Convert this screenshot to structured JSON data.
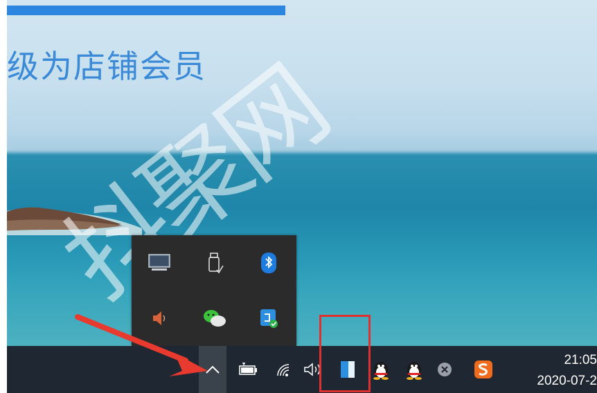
{
  "headline": "级为店铺会员",
  "watermark": "抖聚网",
  "tray_popup": {
    "icons": [
      {
        "name": "display-icon"
      },
      {
        "name": "usb-drive-icon"
      },
      {
        "name": "bluetooth-icon"
      },
      {
        "name": "speaker-icon"
      },
      {
        "name": "wechat-icon"
      },
      {
        "name": "phone-manager-icon"
      }
    ]
  },
  "taskbar": {
    "tray_icons": [
      "chevron-up-icon",
      "battery-icon",
      "wifi-icon",
      "volume-icon",
      "notes-icon",
      "qq-icon",
      "qq-icon-2",
      "close-circle-icon",
      "sogou-icon"
    ],
    "clock": {
      "time": "21:05",
      "date": "2020-07-2"
    }
  },
  "colors": {
    "highlight": "#e03030",
    "arrow": "#e83a2e",
    "taskbar": "#1f2732",
    "popup": "#2b2b2b",
    "accent": "#2c86e0"
  }
}
